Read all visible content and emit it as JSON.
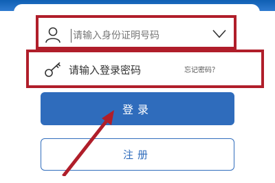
{
  "login_form": {
    "id_field_placeholder": "请输入身份证明号码",
    "password_field_placeholder": "请输入登录密码",
    "forgot_password_link": "忘记密码？",
    "login_button": "登录",
    "register_button": "注册"
  },
  "colors": {
    "header_blue": "#1f6cc0",
    "button_blue": "#2f6cbc",
    "annotation_red": "#b01e2a"
  },
  "icons": {
    "id_field": "user-icon",
    "id_dropdown": "chevron-down-icon",
    "password_field": "key-icon",
    "annotation": "arrow-icon"
  }
}
